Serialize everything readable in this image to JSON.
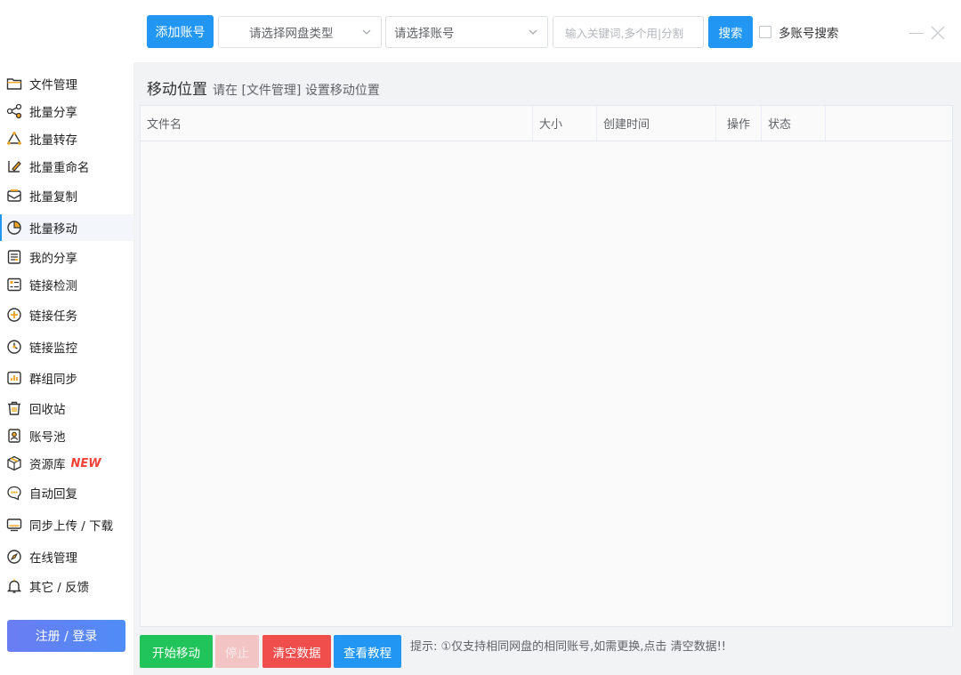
{
  "toolbar": {
    "add_account_label": "添加账号",
    "disk_type_placeholder": "请选择网盘类型",
    "account_placeholder": "请选择账号",
    "keyword_placeholder": "输入关键词,多个用|分割",
    "search_label": "搜索",
    "multi_account_label": "多账号搜索"
  },
  "sidebar": {
    "items": [
      {
        "label": "文件管理",
        "icon": "folder-icon"
      },
      {
        "label": "批量分享",
        "icon": "share-icon"
      },
      {
        "label": "批量转存",
        "icon": "recycle-icon"
      },
      {
        "label": "批量重命名",
        "icon": "rename-icon"
      },
      {
        "label": "批量复制",
        "icon": "copy-icon"
      },
      {
        "label": "批量移动",
        "icon": "move-icon"
      },
      {
        "label": "我的分享",
        "icon": "document-icon"
      },
      {
        "label": "链接检测",
        "icon": "checklist-icon"
      },
      {
        "label": "链接任务",
        "icon": "plus-circle-icon"
      },
      {
        "label": "链接监控",
        "icon": "clock-icon"
      },
      {
        "label": "群组同步",
        "icon": "bar-chart-icon"
      },
      {
        "label": "回收站",
        "icon": "trash-icon"
      },
      {
        "label": "账号池",
        "icon": "contact-icon"
      },
      {
        "label": "资源库",
        "icon": "box-icon",
        "badge": "NEW"
      },
      {
        "label": "自动回复",
        "icon": "chat-icon"
      },
      {
        "label": "同步上传 / 下载",
        "icon": "monitor-icon"
      },
      {
        "label": "在线管理",
        "icon": "compass-icon"
      },
      {
        "label": "其它 / 反馈",
        "icon": "bell-icon"
      }
    ],
    "active_index": 5,
    "login_label": "注册 / 登录"
  },
  "main": {
    "title": "移动位置",
    "subtitle": "请在 [文件管理] 设置移动位置",
    "columns": [
      "文件名",
      "大小",
      "创建时间",
      "操作",
      "状态"
    ],
    "rows": []
  },
  "actions": {
    "start_label": "开始移动",
    "stop_label": "停止",
    "clear_label": "清空数据",
    "tutorial_label": "查看教程"
  },
  "tip": "提示: ①仅支持相同网盘的相同账号,如需更换,点击 清空数据!!",
  "colors": {
    "primary": "#2196f3",
    "success": "#21c45a",
    "danger": "#f04d4d",
    "new_badge": "#f44336"
  }
}
